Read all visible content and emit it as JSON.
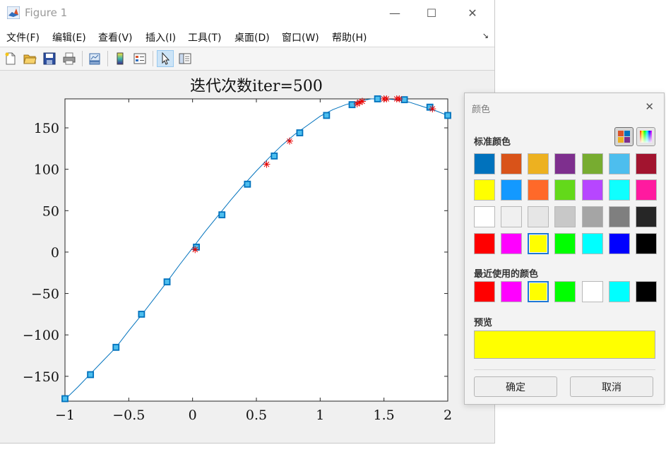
{
  "window": {
    "title": "Figure 1",
    "controls": {
      "minimize": "—",
      "maximize": "☐",
      "close": "✕"
    }
  },
  "menu": {
    "items": [
      "文件(F)",
      "编辑(E)",
      "查看(V)",
      "插入(I)",
      "工具(T)",
      "桌面(D)",
      "窗口(W)",
      "帮助(H)"
    ],
    "overflow": "↘"
  },
  "toolbar": {
    "icons": [
      "new-figure-icon",
      "open-file-icon",
      "save-icon",
      "print-icon",
      "link-plot-icon",
      "insert-colorbar-icon",
      "insert-legend-icon",
      "edit-plot-icon",
      "property-editor-icon"
    ],
    "active": "edit-plot-icon"
  },
  "chart_data": {
    "type": "line",
    "title": "迭代次数iter=500",
    "xlabel": "",
    "ylabel": "",
    "xlim": [
      -1,
      2
    ],
    "ylim": [
      -180,
      185
    ],
    "xticks": [
      -1,
      -0.5,
      0,
      0.5,
      1,
      1.5,
      2
    ],
    "xtick_labels": [
      "−1",
      "−0.5",
      "0",
      "0.5",
      "1",
      "1.5",
      "2"
    ],
    "yticks": [
      -150,
      -100,
      -50,
      0,
      50,
      100,
      150
    ],
    "ytick_labels": [
      "−150",
      "−100",
      "−50",
      "0",
      "50",
      "100",
      "150"
    ],
    "grid": false,
    "series": [
      {
        "kind": "line",
        "color": "#0072bd",
        "x": [
          -1,
          -0.9,
          -0.8,
          -0.7,
          -0.6,
          -0.5,
          -0.4,
          -0.3,
          -0.2,
          -0.1,
          0,
          0.1,
          0.2,
          0.3,
          0.4,
          0.5,
          0.6,
          0.7,
          0.8,
          0.9,
          1.0,
          1.1,
          1.2,
          1.3,
          1.4,
          1.5,
          1.6,
          1.7,
          1.8,
          1.9,
          2.0
        ],
        "y": [
          -178,
          -163,
          -147,
          -131,
          -115,
          -95,
          -76,
          -56,
          -36,
          -15,
          5,
          25,
          44,
          63,
          81,
          98,
          114,
          129,
          142,
          153,
          164,
          172,
          178,
          182,
          185,
          185,
          184,
          181,
          176,
          171,
          165
        ]
      },
      {
        "kind": "square-markers",
        "color": "#0072bd",
        "fill": "#4dbeee",
        "x": [
          -1,
          -0.8,
          -0.6,
          -0.4,
          -0.2,
          0.03,
          0.23,
          0.43,
          0.64,
          0.84,
          1.05,
          1.25,
          1.45,
          1.66,
          1.86,
          2.0
        ],
        "y": [
          -177,
          -148,
          -115,
          -75,
          -36,
          6,
          45,
          82,
          116,
          144,
          165,
          178,
          185,
          184,
          175,
          165
        ]
      },
      {
        "kind": "star-markers",
        "color": "#e60000",
        "x": [
          0.02,
          0.58,
          0.76,
          1.29,
          1.31,
          1.33,
          1.5,
          1.52,
          1.6,
          1.62,
          1.88
        ],
        "y": [
          3,
          106,
          134,
          179,
          181,
          182,
          185,
          185,
          185,
          185,
          173
        ]
      }
    ]
  },
  "dialog": {
    "title": "颜色",
    "close": "✕",
    "standard_label": "标准颜色",
    "modes": [
      "palette-mode-icon",
      "spectrum-mode-icon"
    ],
    "standard_colors": [
      [
        "#0072bd",
        "#d95319",
        "#edb120",
        "#7e2f8e",
        "#77ac30",
        "#4dbeee",
        "#a2142f"
      ],
      [
        "#ffff00",
        "#1399ff",
        "#ff6929",
        "#63d91a",
        "#b746ff",
        "#0ffffe",
        "#ff1a9f"
      ],
      [
        "#ffffff",
        "#f0f0f0",
        "#e6e6e6",
        "#c8c8c8",
        "#a5a5a5",
        "#7f7f7f",
        "#262626"
      ],
      [
        "#ff0000",
        "#ff00ff",
        "#ffff00",
        "#00ff00",
        "#00ffff",
        "#0000ff",
        "#000000"
      ]
    ],
    "standard_selected": [
      3,
      2
    ],
    "recent_label": "最近使用的颜色",
    "recent_colors": [
      "#ff0000",
      "#ff00ff",
      "#ffff00",
      "#00ff00",
      "#ffffff",
      "#00ffff",
      "#000000"
    ],
    "recent_selected": 2,
    "preview_label": "预览",
    "preview_color": "#ffff00",
    "ok_label": "确定",
    "cancel_label": "取消"
  }
}
